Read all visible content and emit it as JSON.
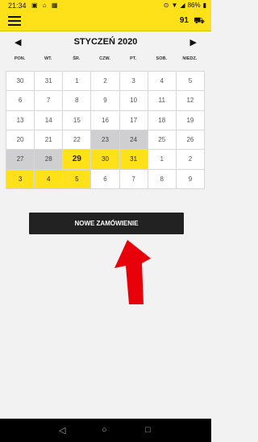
{
  "status": {
    "time": "21:34",
    "battery": "86%"
  },
  "header": {
    "count": "91"
  },
  "calendar": {
    "month_label": "STYCZEŃ 2020",
    "weekdays": [
      "PON.",
      "WT.",
      "ŚR.",
      "CZW.",
      "PT.",
      "SOB.",
      "NIEDZ."
    ],
    "cells": [
      {
        "d": "30",
        "t": ""
      },
      {
        "d": "31",
        "t": ""
      },
      {
        "d": "1",
        "t": ""
      },
      {
        "d": "2",
        "t": ""
      },
      {
        "d": "3",
        "t": ""
      },
      {
        "d": "4",
        "t": ""
      },
      {
        "d": "5",
        "t": ""
      },
      {
        "d": "6",
        "t": ""
      },
      {
        "d": "7",
        "t": ""
      },
      {
        "d": "8",
        "t": ""
      },
      {
        "d": "9",
        "t": ""
      },
      {
        "d": "10",
        "t": ""
      },
      {
        "d": "11",
        "t": ""
      },
      {
        "d": "12",
        "t": ""
      },
      {
        "d": "13",
        "t": ""
      },
      {
        "d": "14",
        "t": ""
      },
      {
        "d": "15",
        "t": ""
      },
      {
        "d": "16",
        "t": ""
      },
      {
        "d": "17",
        "t": ""
      },
      {
        "d": "18",
        "t": ""
      },
      {
        "d": "19",
        "t": ""
      },
      {
        "d": "20",
        "t": ""
      },
      {
        "d": "21",
        "t": ""
      },
      {
        "d": "22",
        "t": ""
      },
      {
        "d": "23",
        "t": "grey"
      },
      {
        "d": "24",
        "t": "grey"
      },
      {
        "d": "25",
        "t": ""
      },
      {
        "d": "26",
        "t": ""
      },
      {
        "d": "27",
        "t": "grey"
      },
      {
        "d": "28",
        "t": "grey"
      },
      {
        "d": "29",
        "t": "yellow today"
      },
      {
        "d": "30",
        "t": "yellow"
      },
      {
        "d": "31",
        "t": "yellow"
      },
      {
        "d": "1",
        "t": ""
      },
      {
        "d": "2",
        "t": ""
      },
      {
        "d": "3",
        "t": "yellow"
      },
      {
        "d": "4",
        "t": "yellow"
      },
      {
        "d": "5",
        "t": "yellow"
      },
      {
        "d": "6",
        "t": ""
      },
      {
        "d": "7",
        "t": ""
      },
      {
        "d": "8",
        "t": ""
      },
      {
        "d": "9",
        "t": ""
      }
    ]
  },
  "actions": {
    "new_order_label": "NOWE ZAMÓWIENIE"
  },
  "colors": {
    "accent": "#ffe11a",
    "highlight_grey": "#cfcfd2",
    "arrow": "#e8000b",
    "button": "#222222"
  },
  "icons": [
    "hamburger-menu-icon",
    "truck-icon",
    "chevron-left-icon",
    "chevron-right-icon",
    "back-nav-icon",
    "home-nav-icon",
    "recents-nav-icon"
  ]
}
